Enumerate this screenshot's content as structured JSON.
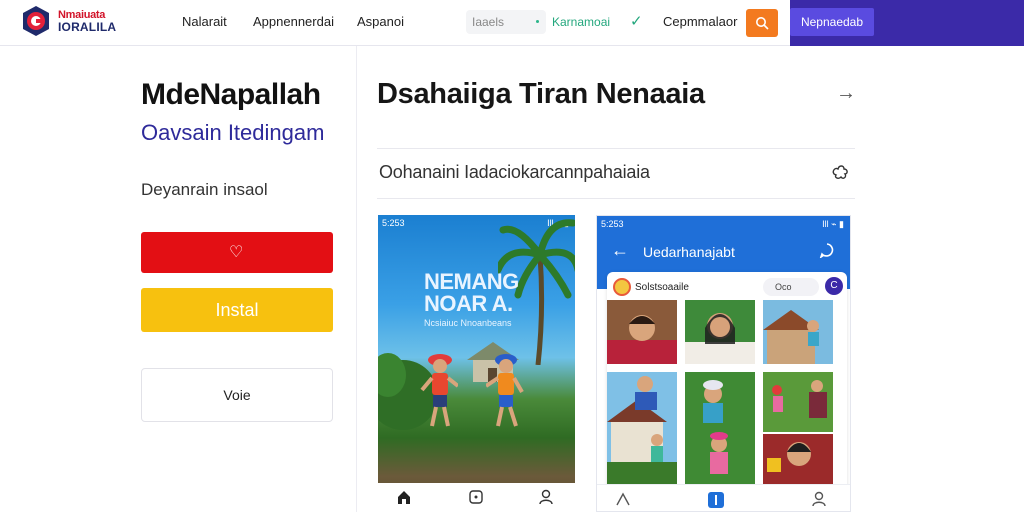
{
  "header": {
    "logo_top": "Nmaiuata",
    "logo_bottom": "IORALILA",
    "nav": [
      "Nalarait",
      "Appnennerdai",
      "Aspanoi"
    ],
    "search_placeholder": "Iaaels",
    "green_link": "Karnamoai",
    "cta": "Cepmmalaor",
    "purple_button": "Nepnaedab"
  },
  "app": {
    "title": "MdeNapallah",
    "subtitle": "Oavsain Itedingam",
    "developer": "Deyanrain insaol",
    "install_label": "Instal",
    "outline_label": "Voie"
  },
  "section": {
    "title": "Dsahaiiga Tiran Nenaaia",
    "description": "Oohanaini Iadaciokarcannpahaiaia"
  },
  "screenshot1": {
    "status_time": "5:253",
    "status_right": "Ill ⌁ ▮",
    "title_line1": "NEMANG",
    "title_line2": "NOAR A.",
    "subtitle": "Ncsiaiuc Nnoanbeans"
  },
  "screenshot2": {
    "status_time": "5:253",
    "status_right": "Ill ⌁ ▮",
    "title": "Uedarhanajabt",
    "card_name": "Solstsoaaile",
    "pill": "Oco",
    "badge": "C"
  },
  "colors": {
    "brand_red": "#e30f14",
    "install_yellow": "#f7c10f",
    "accent_purple": "#3b2aa8",
    "accent_orange": "#f37a1f",
    "accent_green": "#23a77d",
    "app_blue": "#1f6fd8"
  }
}
